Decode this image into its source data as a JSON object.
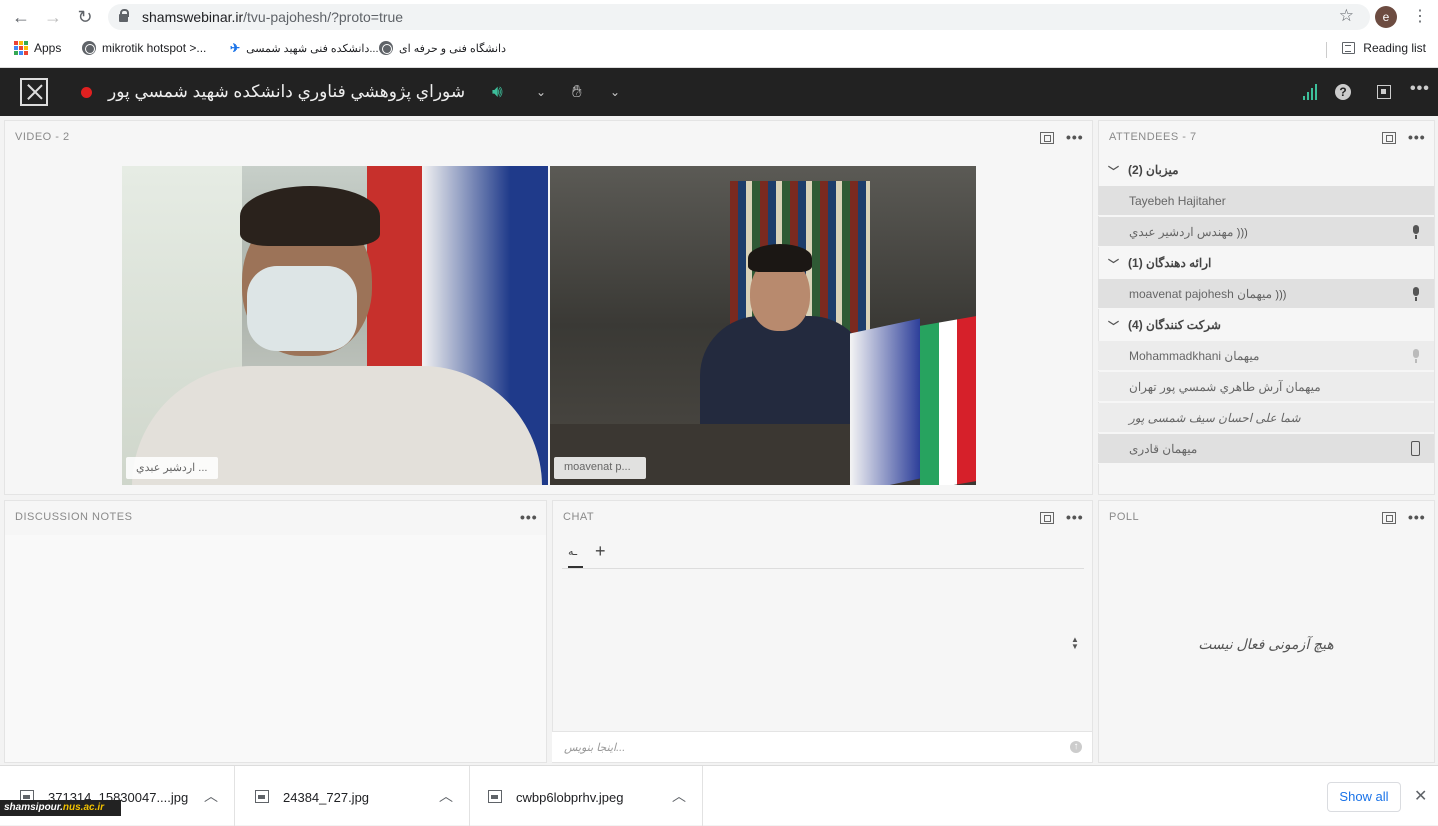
{
  "browser": {
    "url_host": "shamswebinar.ir",
    "url_path": "/tvu-pajohesh/?proto=true",
    "profile_initial": "e",
    "bookmarks": [
      {
        "label": "Apps"
      },
      {
        "label": "mikrotik hotspot >..."
      },
      {
        "label": "دانشکده فنی شهید شمسی..."
      },
      {
        "label": "دانشگاه فنی و حرفه ای"
      }
    ],
    "reading_list": "Reading list"
  },
  "app": {
    "meeting_title": "شوراي پژوهشي فناوري دانشکده شهيد شمسي پور"
  },
  "video": {
    "title": "VIDEO",
    "count": "- 2",
    "tiles": [
      {
        "name": "اردشیر عبدي ..."
      },
      {
        "name": "moavenat p..."
      }
    ]
  },
  "attendees": {
    "title": "ATTENDEES",
    "count": "- 7",
    "groups": [
      {
        "label": "ميزبان (2)"
      },
      {
        "label": "ارائه دهندگان (1)"
      },
      {
        "label": "شرکت کنندگان (4)"
      }
    ],
    "rows": [
      {
        "name": "Tayebeh Hajitaher"
      },
      {
        "name": "مهندس اردشير عبدي"
      },
      {
        "name": "moavenat pajohesh میهمان"
      },
      {
        "name": "Mohammadkhani میهمان"
      },
      {
        "name": "ميهمان آرش طاهري شمسي پور تهران"
      },
      {
        "name": "شما علی احسان سیف شمسی پور"
      },
      {
        "name": "میهمان قادری"
      }
    ]
  },
  "notes": {
    "title": "DISCUSSION NOTES"
  },
  "chat": {
    "title": "CHAT",
    "tab_label": "ـه",
    "input_placeholder": "اینجا بنویس..."
  },
  "poll": {
    "title": "POLL",
    "empty_text": "هیچ آزمونی فعال نیست"
  },
  "downloads": {
    "items": [
      {
        "name": "371314_15830047....jpg"
      },
      {
        "name": "24384_727.jpg"
      },
      {
        "name": "cwbp6lobprhv.jpeg"
      }
    ],
    "show_all": "Show all"
  },
  "watermark": {
    "prefix": "shamsipour.",
    "suffix": "nus.ac.ir"
  },
  "colors": {
    "accent": "#3dbf9b",
    "recording": "#e02020",
    "appbar": "#222222"
  }
}
